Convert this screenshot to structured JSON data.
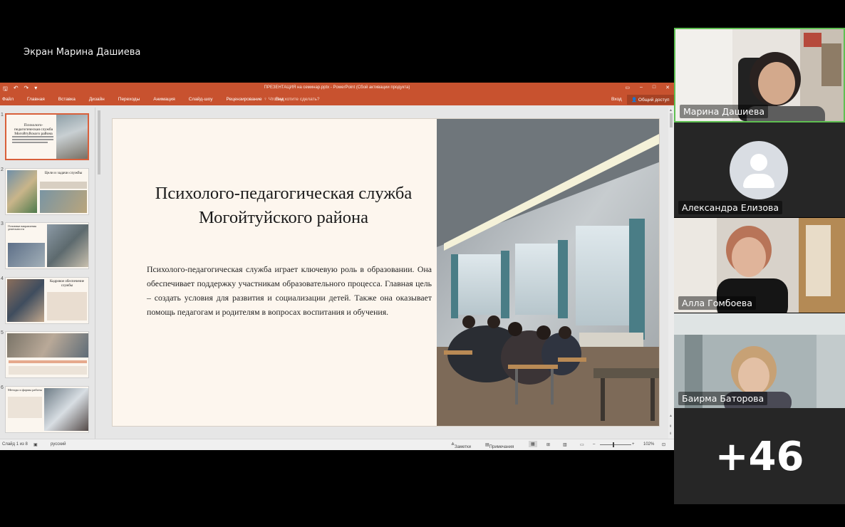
{
  "meeting": {
    "screen_share_label": "Экран Марина Дашиева",
    "more_participants": "+46",
    "participants": [
      {
        "name": "Марина Дашиева",
        "active_speaker": true
      },
      {
        "name": "Александра Елизова",
        "avatar": "person-placeholder-icon"
      },
      {
        "name": "Алла Гомбоева"
      },
      {
        "name": "Баирма Баторова"
      }
    ]
  },
  "powerpoint": {
    "window_title": "ПРЕЗЕНТАЦИЯ на семинар.pptx - PowerPoint (Сбой активации продукта)",
    "ribbon_tabs": [
      "Файл",
      "Главная",
      "Вставка",
      "Дизайн",
      "Переходы",
      "Анимация",
      "Слайд-шоу",
      "Рецензирование",
      "Вид"
    ],
    "tell_me": "Что вы хотите сделать?",
    "sign_in": "Вход",
    "share": "Общий доступ",
    "slide": {
      "title": "Психолого-педагогическая служба Могойтуйского района",
      "body": "Психолого-педагогическая служба играет ключевую роль в образовании. Она обеспечивает поддержку участникам образовательного процесса. Главная цель – создать условия для развития и социализации детей. Также она оказывает помощь педагогам и родителям в вопросах воспитания и обучения."
    },
    "thumbnails": [
      {
        "num": "1",
        "title": "Психолого-педагогическая служба Могойтуйского района"
      },
      {
        "num": "2",
        "title": "Цели и задачи службы"
      },
      {
        "num": "3",
        "title": "Основные направления деятельности"
      },
      {
        "num": "4",
        "title": "Кадровое обеспечение службы"
      },
      {
        "num": "5",
        "title": ""
      },
      {
        "num": "6",
        "title": "Методы и формы работы"
      }
    ],
    "status": {
      "slide_counter": "Слайд 1 из 8",
      "language": "русский",
      "notes": "Заметки",
      "comments": "Примечания",
      "zoom": "102%"
    }
  },
  "colors": {
    "ppt_accent": "#c8522f",
    "active_border": "#5fbf52",
    "slide_bg": "#fdf6ee"
  }
}
